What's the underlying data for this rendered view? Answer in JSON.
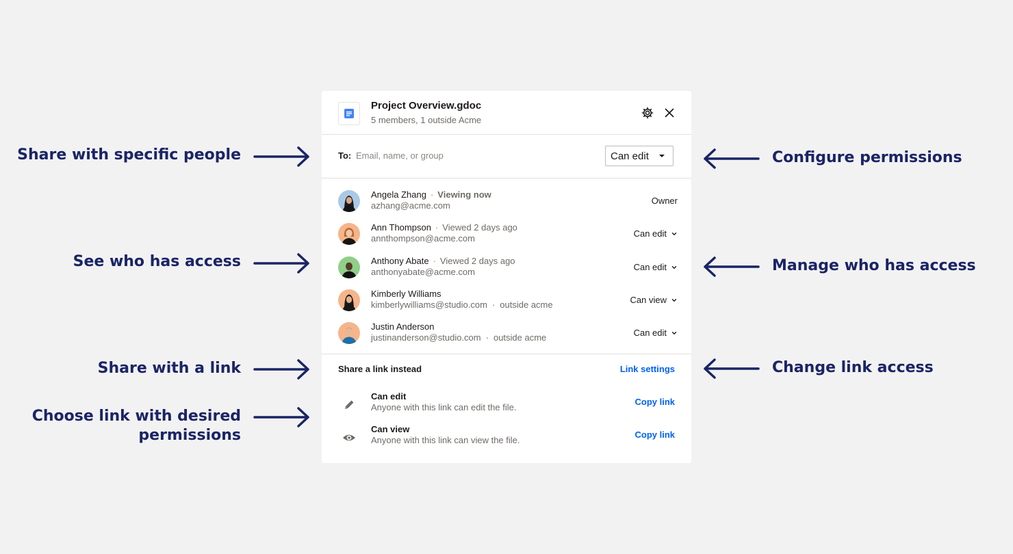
{
  "annotations": {
    "share_specific": "Share with specific people",
    "see_access": "See who has access",
    "share_link": "Share with a link",
    "choose_link_line1": "Choose link with desired",
    "choose_link_line2": "permissions",
    "configure_permissions": "Configure permissions",
    "manage_access": "Manage who has access",
    "change_link_access": "Change link access"
  },
  "colors": {
    "background": "#f2f2f2",
    "annotation": "#1a2466",
    "link_blue": "#0061fe",
    "doc_blue": "#4285f4"
  },
  "header": {
    "file_icon": "google-doc-icon",
    "title": "Project Overview.gdoc",
    "subtitle": "5 members, 1 outside Acme",
    "settings_icon": "gear-icon",
    "close_icon": "close-icon"
  },
  "share": {
    "to_label": "To:",
    "placeholder": "Email, name, or group",
    "permission": "Can edit"
  },
  "members": [
    {
      "name": "Angela Zhang",
      "status": "Viewing now",
      "email": "azhang@acme.com",
      "external": "",
      "role": "Owner"
    },
    {
      "name": "Ann Thompson",
      "status": "Viewed 2 days ago",
      "email": "annthompson@acme.com",
      "external": "",
      "role": "Can edit"
    },
    {
      "name": "Anthony Abate",
      "status": "Viewed 2 days ago",
      "email": "anthonyabate@acme.com",
      "external": "",
      "role": "Can edit"
    },
    {
      "name": "Kimberly Williams",
      "status": "",
      "email": "kimberlywilliams@studio.com",
      "external": "outside acme",
      "role": "Can view"
    },
    {
      "name": "Justin Anderson",
      "status": "",
      "email": "justinanderson@studio.com",
      "external": "outside acme",
      "role": "Can edit"
    }
  ],
  "link_section": {
    "title": "Share a link instead",
    "settings_label": "Link settings",
    "links": [
      {
        "icon": "pencil-icon",
        "title": "Can edit",
        "description": "Anyone with this link can edit the file.",
        "action": "Copy link"
      },
      {
        "icon": "eye-icon",
        "title": "Can view",
        "description": "Anyone with this link can view the file.",
        "action": "Copy link"
      }
    ]
  }
}
